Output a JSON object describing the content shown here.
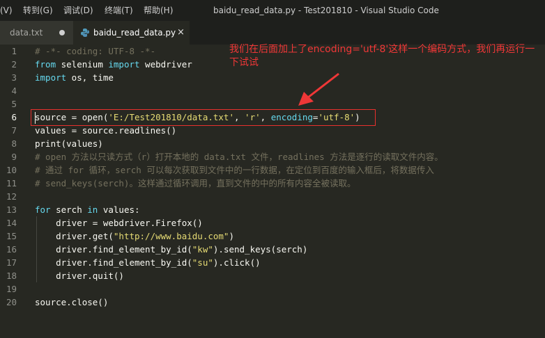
{
  "titlebar": {
    "menu": [
      "(V)",
      "转到(G)",
      "调试(D)",
      "终端(T)",
      "帮助(H)"
    ],
    "window_title": "baidu_read_data.py - Test201810 - Visual Studio Code"
  },
  "tabs": [
    {
      "label": "data.txt",
      "modified": true
    },
    {
      "label": "baidu_read_data.py",
      "close": "×",
      "active": true
    }
  ],
  "editor": {
    "active_line": 6,
    "lines": [
      {
        "n": "1",
        "tokens": [
          {
            "t": "# -*- coding: UTF-8 -*-",
            "c": "cm"
          }
        ]
      },
      {
        "n": "2",
        "tokens": [
          {
            "t": "from",
            "c": "kw"
          },
          {
            "t": " selenium ",
            "c": "id"
          },
          {
            "t": "import",
            "c": "kw"
          },
          {
            "t": " webdriver",
            "c": "id"
          }
        ]
      },
      {
        "n": "3",
        "tokens": [
          {
            "t": "import",
            "c": "kw"
          },
          {
            "t": " os, time",
            "c": "id"
          }
        ]
      },
      {
        "n": "4",
        "tokens": []
      },
      {
        "n": "5",
        "tokens": []
      },
      {
        "n": "6",
        "tokens": [
          {
            "t": "source = open(",
            "c": "id"
          },
          {
            "t": "'E:/Test201810/data.txt'",
            "c": "str"
          },
          {
            "t": ", ",
            "c": "id"
          },
          {
            "t": "'r'",
            "c": "str"
          },
          {
            "t": ", ",
            "c": "id"
          },
          {
            "t": "encoding",
            "c": "param"
          },
          {
            "t": "=",
            "c": "id"
          },
          {
            "t": "'utf-8'",
            "c": "str"
          },
          {
            "t": ")",
            "c": "id"
          }
        ]
      },
      {
        "n": "7",
        "tokens": [
          {
            "t": "values = source.readlines()",
            "c": "id"
          }
        ]
      },
      {
        "n": "8",
        "tokens": [
          {
            "t": "print(values)",
            "c": "id"
          }
        ]
      },
      {
        "n": "9",
        "tokens": [
          {
            "t": "# open 方法以只读方式（r）打开本地的 data.txt 文件，readlines 方法是逐行的读取文件内容。",
            "c": "cm"
          }
        ]
      },
      {
        "n": "10",
        "tokens": [
          {
            "t": "# 通过 for 循环，serch 可以每次获取到文件中的一行数据，在定位到百度的输入框后，将数据传入",
            "c": "cm"
          }
        ]
      },
      {
        "n": "11",
        "tokens": [
          {
            "t": "# send_keys(serch)。这样通过循环调用，直到文件的中的所有内容全被读取。",
            "c": "cm"
          }
        ]
      },
      {
        "n": "12",
        "tokens": []
      },
      {
        "n": "13",
        "tokens": [
          {
            "t": "for",
            "c": "kw"
          },
          {
            "t": " serch ",
            "c": "id"
          },
          {
            "t": "in",
            "c": "kw"
          },
          {
            "t": " values:",
            "c": "id"
          }
        ]
      },
      {
        "n": "14",
        "indent": true,
        "tokens": [
          {
            "t": "    driver = webdriver.Firefox()",
            "c": "id"
          }
        ]
      },
      {
        "n": "15",
        "indent": true,
        "tokens": [
          {
            "t": "    driver.get(",
            "c": "id"
          },
          {
            "t": "\"http://www.baidu.com\"",
            "c": "str"
          },
          {
            "t": ")",
            "c": "id"
          }
        ]
      },
      {
        "n": "16",
        "indent": true,
        "tokens": [
          {
            "t": "    driver.find_element_by_id(",
            "c": "id"
          },
          {
            "t": "\"kw\"",
            "c": "str"
          },
          {
            "t": ").send_keys(serch)",
            "c": "id"
          }
        ]
      },
      {
        "n": "17",
        "indent": true,
        "tokens": [
          {
            "t": "    driver.find_element_by_id(",
            "c": "id"
          },
          {
            "t": "\"su\"",
            "c": "str"
          },
          {
            "t": ").click()",
            "c": "id"
          }
        ]
      },
      {
        "n": "18",
        "indent": true,
        "tokens": [
          {
            "t": "    driver.quit()",
            "c": "id"
          }
        ]
      },
      {
        "n": "19",
        "tokens": []
      },
      {
        "n": "20",
        "tokens": [
          {
            "t": "source.close()",
            "c": "id"
          }
        ]
      }
    ]
  },
  "annotation": {
    "text": "我们在后面加上了encoding='utf-8'这样一个编码方式，我们再运行一下试试",
    "color": "#ef3737"
  },
  "colors": {
    "background": "#272822",
    "comment": "#75715e",
    "keyword": "#66d9ef",
    "string": "#e6db74",
    "text": "#f8f8f2",
    "highlight_box": "#e8302d"
  }
}
